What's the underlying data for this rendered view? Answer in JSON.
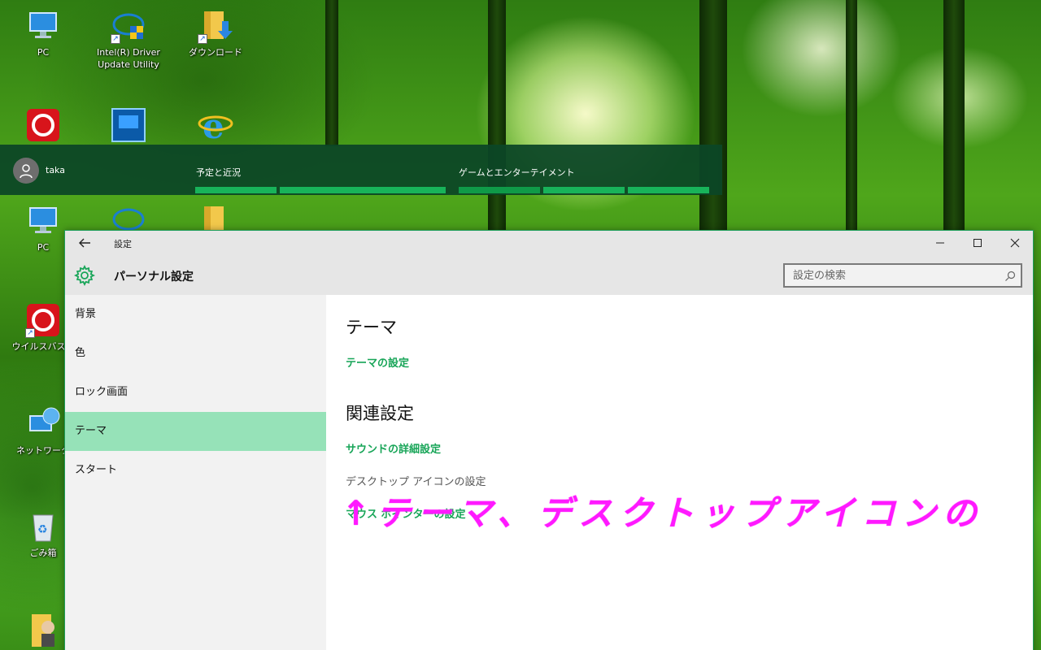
{
  "desktop": {
    "icons": [
      {
        "name": "pc",
        "label": "PC"
      },
      {
        "name": "intel-driver",
        "label": "Intel(R) Driver Update Utility"
      },
      {
        "name": "download",
        "label": "ダウンロード"
      },
      {
        "name": "pc-2",
        "label": "PC"
      },
      {
        "name": "virus-buster",
        "label": "ウイルスバスタ"
      },
      {
        "name": "network",
        "label": "ネットワーク"
      },
      {
        "name": "trash",
        "label": "ごみ箱"
      }
    ]
  },
  "start_menu": {
    "user": "taka",
    "groups": [
      "予定と近況",
      "ゲームとエンターテイメント"
    ]
  },
  "window": {
    "title": "設定",
    "header_title": "パーソナル設定",
    "search_placeholder": "設定の検索",
    "sidebar": [
      {
        "label": "背景",
        "selected": false
      },
      {
        "label": "色",
        "selected": false
      },
      {
        "label": "ロック画面",
        "selected": false
      },
      {
        "label": "テーマ",
        "selected": true
      },
      {
        "label": "スタート",
        "selected": false
      }
    ],
    "content": {
      "section1_title": "テーマ",
      "section1_link": "テーマの設定",
      "section2_title": "関連設定",
      "link_sound": "サウンドの詳細設定",
      "text_desktop_icons": "デスクトップ アイコンの設定",
      "link_mouse_pointer": "マウス ポインターの設定"
    }
  },
  "annotation": "↑テーマ、デスクトップアイコンの",
  "colors": {
    "accent": "#18a558",
    "selected_nav": "#96e2b8",
    "annotation": "#ff19ff"
  }
}
